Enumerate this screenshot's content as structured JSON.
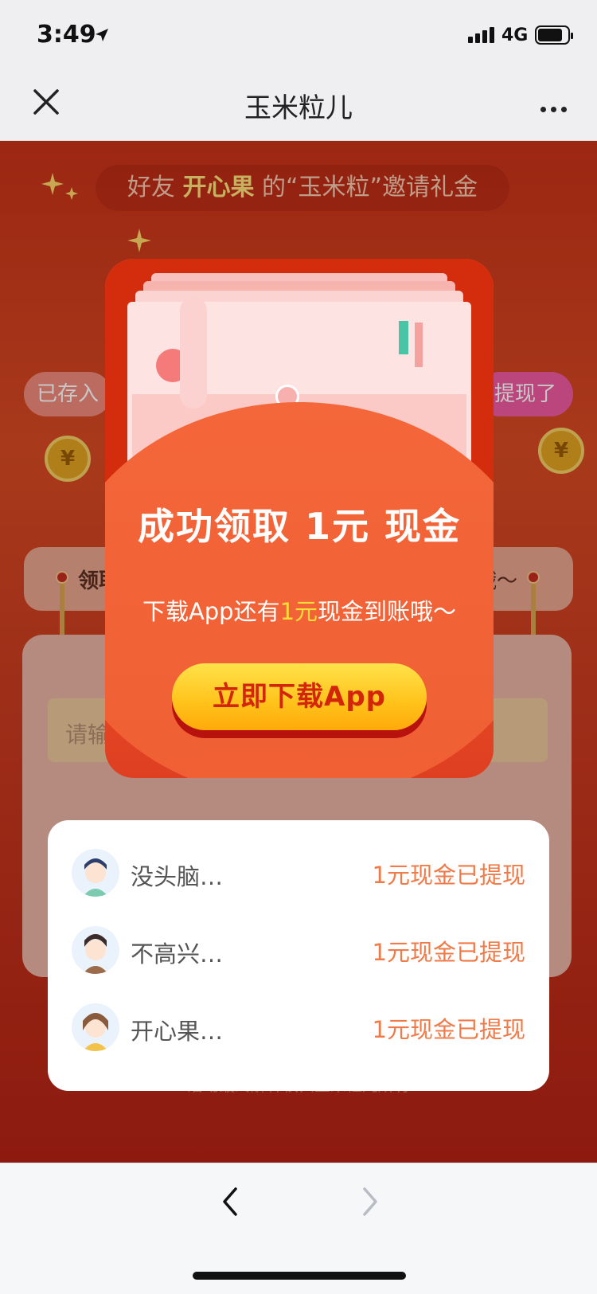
{
  "status": {
    "time": "3:49",
    "network": "4G"
  },
  "nav": {
    "title": "玉米粒儿"
  },
  "background": {
    "invite_prefix": "好友",
    "invite_name": "开心果",
    "invite_suffix": "的“玉米粒”邀请礼金",
    "pill_left": "已存入",
    "pill_right": "提现了",
    "section_left": "领取",
    "section_right": "哦～",
    "input_placeholder": "请输",
    "footer": "活动最终解释权归玉米粒儿所有"
  },
  "modal": {
    "headline": "成功领取 1元 现金",
    "sub_before": "下载App还有",
    "sub_highlight": "1元",
    "sub_after": "现金到账哦～",
    "button": "立即下载App"
  },
  "winners": [
    {
      "name": "没头脑…",
      "status": "1元现金已提现"
    },
    {
      "name": "不高兴…",
      "status": "1元现金已提现"
    },
    {
      "name": "开心果…",
      "status": "1元现金已提现"
    }
  ],
  "colors": {
    "accent": "#f07a48",
    "modal_bg": "#ef5f34",
    "button": "#ffc21a"
  }
}
